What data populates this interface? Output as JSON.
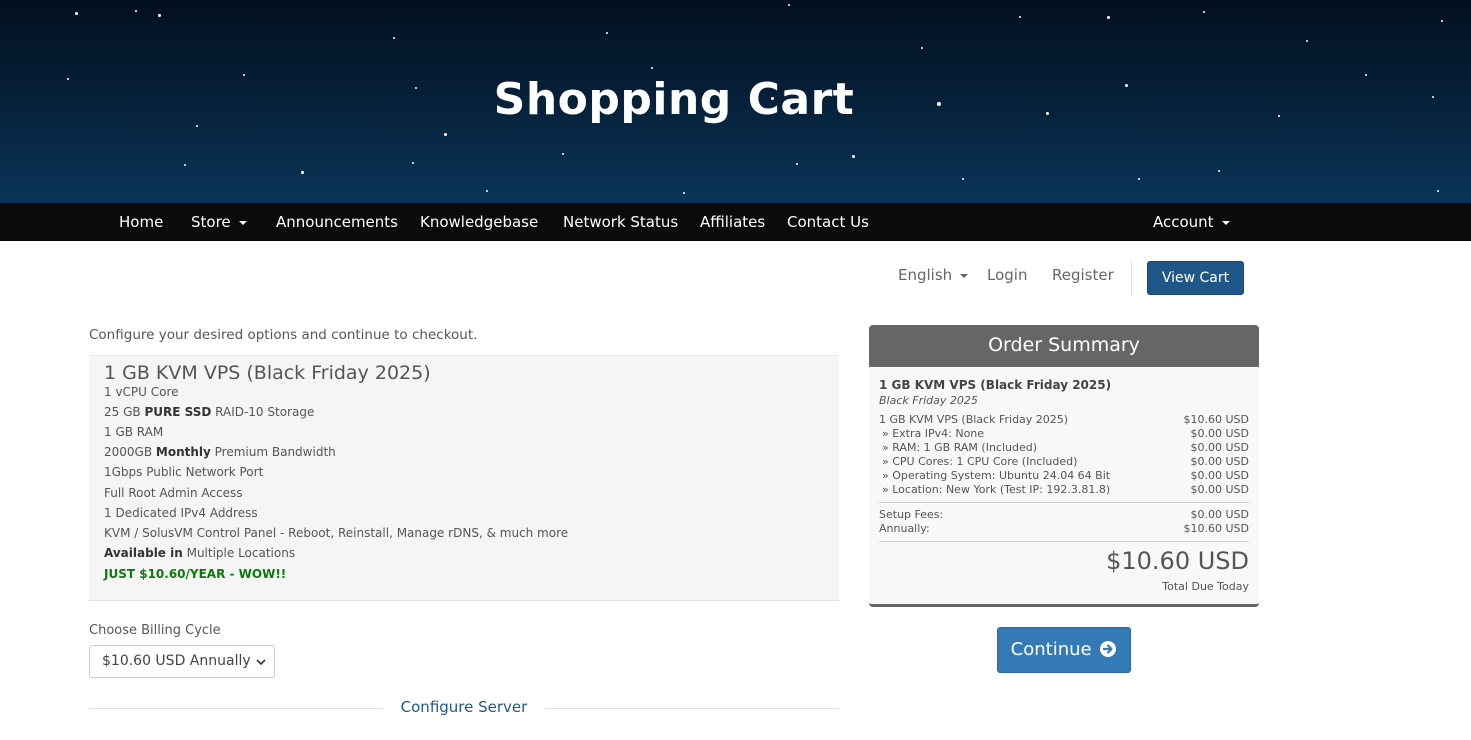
{
  "header": {
    "title": "Shopping Cart"
  },
  "nav": {
    "home": "Home",
    "store": "Store",
    "announcements": "Announcements",
    "knowledgebase": "Knowledgebase",
    "network_status": "Network Status",
    "affiliates": "Affiliates",
    "contact": "Contact Us",
    "account": "Account"
  },
  "toplinks": {
    "language": "English",
    "login": "Login",
    "register": "Register",
    "view_cart": "View Cart"
  },
  "product": {
    "intro": "Configure your desired options and continue to checkout.",
    "name": "1 GB KVM VPS (Black Friday 2025)",
    "features": [
      {
        "pre": "1 vCPU Core",
        "bold": "",
        "post": ""
      },
      {
        "pre": "25 GB ",
        "bold": "PURE SSD",
        "post": " RAID-10 Storage"
      },
      {
        "pre": "1 GB RAM",
        "bold": "",
        "post": ""
      },
      {
        "pre": "2000GB ",
        "bold": "Monthly",
        "post": " Premium Bandwidth"
      },
      {
        "pre": "1Gbps Public Network Port",
        "bold": "",
        "post": ""
      },
      {
        "pre": "Full Root Admin Access",
        "bold": "",
        "post": ""
      },
      {
        "pre": "1 Dedicated IPv4 Address",
        "bold": "",
        "post": ""
      },
      {
        "pre": "KVM / SolusVM Control Panel - Reboot, Reinstall, Manage rDNS, & much more",
        "bold": "",
        "post": ""
      },
      {
        "pre": "",
        "bold": "Available in",
        "post": " Multiple Locations"
      }
    ],
    "promo": "JUST $10.60/YEAR - WOW!!"
  },
  "billing": {
    "label": "Choose Billing Cycle",
    "selected": "$10.60 USD Annually"
  },
  "configure_server": "Configure Server",
  "summary": {
    "title": "Order Summary",
    "product_name": "1 GB KVM VPS (Black Friday 2025)",
    "group": "Black Friday 2025",
    "lines": [
      {
        "label": "1 GB KVM VPS (Black Friday 2025)",
        "price": "$10.60 USD"
      },
      {
        "label": "» Extra IPv4: None",
        "price": "$0.00 USD"
      },
      {
        "label": "» RAM: 1 GB RAM (Included)",
        "price": "$0.00 USD"
      },
      {
        "label": "» CPU Cores: 1 CPU Core (Included)",
        "price": "$0.00 USD"
      },
      {
        "label": "» Operating System: Ubuntu 24.04 64 Bit",
        "price": "$0.00 USD"
      },
      {
        "label": "» Location: New York (Test IP: 192.3.81.8)",
        "price": "$0.00 USD"
      }
    ],
    "fees": [
      {
        "label": "Setup Fees:",
        "price": "$0.00 USD"
      },
      {
        "label": "Annually:",
        "price": "$10.60 USD"
      }
    ],
    "total": "$10.60 USD",
    "total_label": "Total Due Today"
  },
  "continue_label": "Continue",
  "colors": {
    "nav_bg": "#0b0b0b",
    "primary": "#337ab7",
    "view_cart": "#1f5888",
    "promo": "#0a7a0a"
  }
}
